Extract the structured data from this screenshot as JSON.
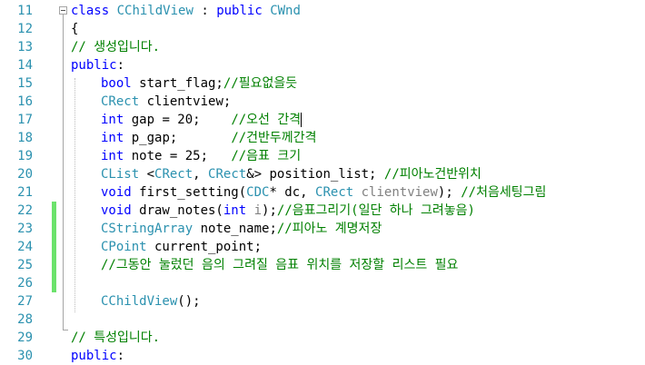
{
  "editor": {
    "lines": [
      {
        "n": "11",
        "tokens": [
          {
            "c": "kw",
            "t": "class"
          },
          {
            "c": "txt",
            "t": " "
          },
          {
            "c": "cls",
            "t": "CChildView"
          },
          {
            "c": "txt",
            "t": " : "
          },
          {
            "c": "kw",
            "t": "public"
          },
          {
            "c": "txt",
            "t": " "
          },
          {
            "c": "cls",
            "t": "CWnd"
          }
        ]
      },
      {
        "n": "12",
        "tokens": [
          {
            "c": "txt",
            "t": "{"
          }
        ]
      },
      {
        "n": "13",
        "tokens": [
          {
            "c": "cmt",
            "t": "// 생성입니다."
          }
        ]
      },
      {
        "n": "14",
        "tokens": [
          {
            "c": "kw",
            "t": "public"
          },
          {
            "c": "txt",
            "t": ":"
          }
        ]
      },
      {
        "n": "15",
        "indent": true,
        "tokens": [
          {
            "c": "kw",
            "t": "bool"
          },
          {
            "c": "txt",
            "t": " start_flag;"
          },
          {
            "c": "cmt",
            "t": "//필요없을듯"
          }
        ]
      },
      {
        "n": "16",
        "indent": true,
        "tokens": [
          {
            "c": "type",
            "t": "CRect"
          },
          {
            "c": "txt",
            "t": " clientview;"
          }
        ]
      },
      {
        "n": "17",
        "indent": true,
        "tokens": [
          {
            "c": "kw",
            "t": "int"
          },
          {
            "c": "txt",
            "t": " gap = 20;    "
          },
          {
            "c": "cmt",
            "t": "//오선 간격"
          }
        ]
      },
      {
        "n": "18",
        "indent": true,
        "tokens": [
          {
            "c": "kw",
            "t": "int"
          },
          {
            "c": "txt",
            "t": " p_gap;       "
          },
          {
            "c": "cmt",
            "t": "//건반두께간격"
          }
        ]
      },
      {
        "n": "19",
        "indent": true,
        "tokens": [
          {
            "c": "kw",
            "t": "int"
          },
          {
            "c": "txt",
            "t": " note = 25;   "
          },
          {
            "c": "cmt",
            "t": "//음표 크기"
          }
        ]
      },
      {
        "n": "20",
        "indent": true,
        "tokens": [
          {
            "c": "type",
            "t": "CList"
          },
          {
            "c": "txt",
            "t": " <"
          },
          {
            "c": "type",
            "t": "CRect"
          },
          {
            "c": "txt",
            "t": ", "
          },
          {
            "c": "type",
            "t": "CRect"
          },
          {
            "c": "txt",
            "t": "&> position_list; "
          },
          {
            "c": "cmt",
            "t": "//피아노건반위치"
          }
        ]
      },
      {
        "n": "21",
        "indent": true,
        "tokens": [
          {
            "c": "kw",
            "t": "void"
          },
          {
            "c": "txt",
            "t": " first_setting("
          },
          {
            "c": "type",
            "t": "CDC"
          },
          {
            "c": "txt",
            "t": "* dc, "
          },
          {
            "c": "type",
            "t": "CRect"
          },
          {
            "c": "txt",
            "t": " "
          },
          {
            "c": "param",
            "t": "clientview"
          },
          {
            "c": "txt",
            "t": "); "
          },
          {
            "c": "cmt",
            "t": "//처음세팅그림"
          }
        ]
      },
      {
        "n": "22",
        "indent": true,
        "changed": true,
        "tokens": [
          {
            "c": "kw",
            "t": "void"
          },
          {
            "c": "txt",
            "t": " draw_notes("
          },
          {
            "c": "kw",
            "t": "int"
          },
          {
            "c": "txt",
            "t": " "
          },
          {
            "c": "param",
            "t": "i"
          },
          {
            "c": "txt",
            "t": ");"
          },
          {
            "c": "cmt",
            "t": "//음표그리기(일단 하나 그려놓음)"
          }
        ]
      },
      {
        "n": "23",
        "indent": true,
        "changed": true,
        "tokens": [
          {
            "c": "type",
            "t": "CStringArray"
          },
          {
            "c": "txt",
            "t": " note_name;"
          },
          {
            "c": "cmt",
            "t": "//피아노 계명저장"
          }
        ]
      },
      {
        "n": "24",
        "indent": true,
        "changed": true,
        "tokens": [
          {
            "c": "type",
            "t": "CPoint"
          },
          {
            "c": "txt",
            "t": " current_point;"
          }
        ]
      },
      {
        "n": "25",
        "indent": true,
        "changed": true,
        "tokens": [
          {
            "c": "cmt",
            "t": "//그동안 눌렀던 음의 그려질 음표 위치를 저장할 리스트 필요"
          }
        ]
      },
      {
        "n": "26",
        "indent": true,
        "changed": true,
        "tokens": []
      },
      {
        "n": "27",
        "indent": true,
        "tokens": [
          {
            "c": "type",
            "t": "CChildView"
          },
          {
            "c": "txt",
            "t": "();"
          }
        ]
      },
      {
        "n": "28",
        "tokens": []
      },
      {
        "n": "29",
        "tokens": [
          {
            "c": "cmt",
            "t": "// 특성입니다."
          }
        ]
      },
      {
        "n": "30",
        "tokens": [
          {
            "c": "kw",
            "t": "public"
          },
          {
            "c": "txt",
            "t": ":"
          }
        ]
      }
    ]
  }
}
